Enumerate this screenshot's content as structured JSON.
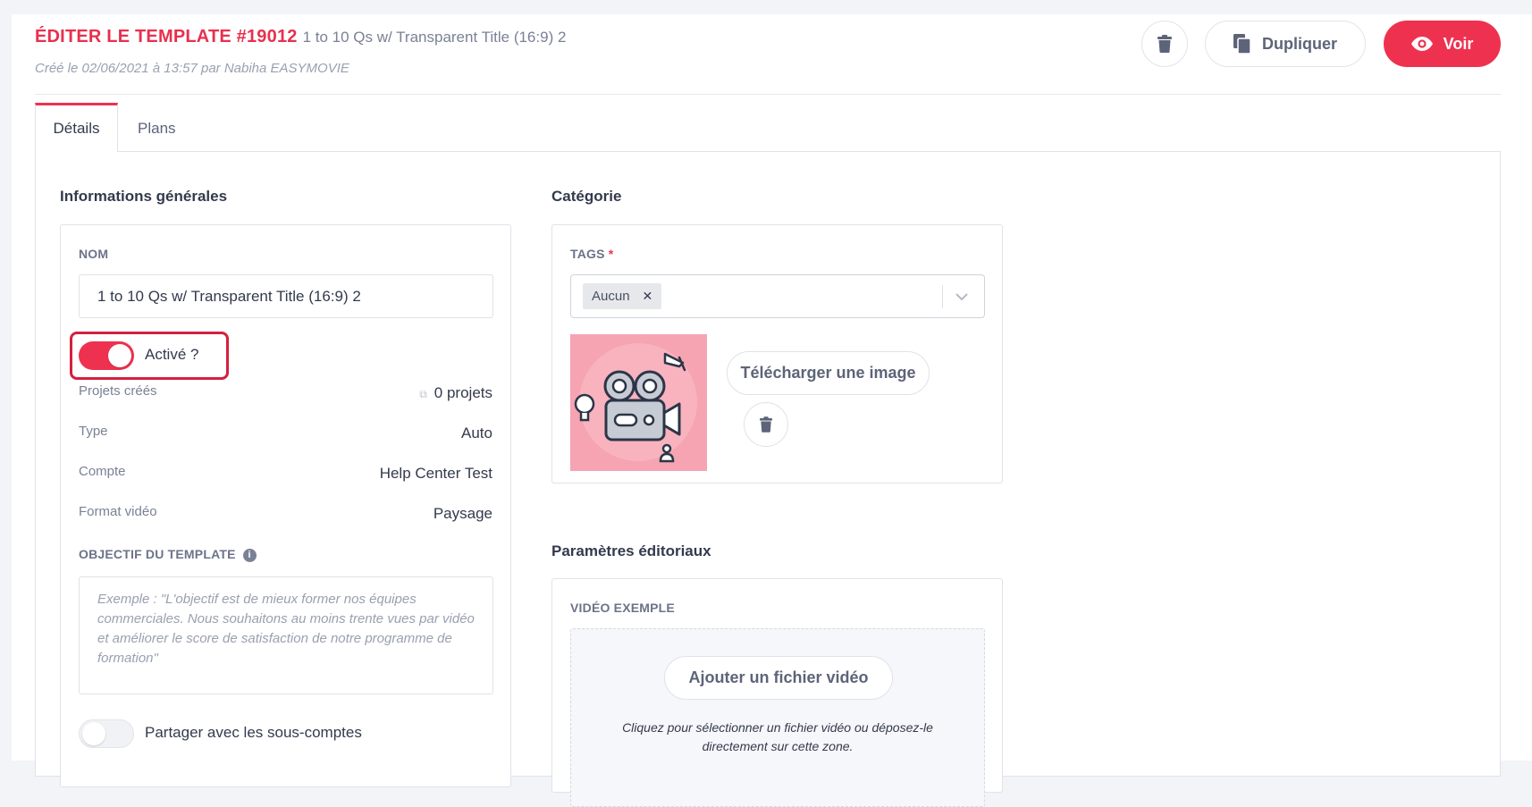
{
  "header": {
    "title": "ÉDITER LE TEMPLATE #19012",
    "template_name": "1 to 10 Qs w/ Transparent Title (16:9) 2",
    "created_info": "Créé le 02/06/2021 à 13:57 par Nabiha EASYMOVIE",
    "duplicate_label": "Dupliquer",
    "view_label": "Voir"
  },
  "tabs": [
    {
      "label": "Détails",
      "active": true
    },
    {
      "label": "Plans",
      "active": false
    }
  ],
  "general": {
    "section_title": "Informations générales",
    "name_label": "NOM",
    "name_value": "1 to 10 Qs w/ Transparent Title (16:9) 2",
    "active_label": "Activé ?",
    "active": true,
    "rows": [
      {
        "key": "Projets créés",
        "value": "0 projets"
      },
      {
        "key": "Type",
        "value": "Auto"
      },
      {
        "key": "Compte",
        "value": "Help Center Test"
      },
      {
        "key": "Format vidéo",
        "value": "Paysage"
      }
    ],
    "objective_label": "OBJECTIF DU TEMPLATE",
    "objective_placeholder": "Exemple : \"L'objectif est de mieux former nos équipes commerciales. Nous souhaitons au moins trente vues par vidéo et améliorer le score de satisfaction de notre programme de formation\"",
    "share_label": "Partager avec les sous-comptes",
    "share": false
  },
  "category": {
    "section_title": "Catégorie",
    "tags_label": "TAGS",
    "required_mark": "*",
    "tags": [
      "Aucun"
    ],
    "upload_label": "Télécharger une image"
  },
  "editorial": {
    "section_title": "Paramètres éditoriaux",
    "video_label": "VIDÉO EXEMPLE",
    "add_video_label": "Ajouter un fichier vidéo",
    "drop_hint_1": "Cliquez pour sélectionner un fichier vidéo ou déposez-le",
    "drop_hint_2": "directement sur cette zone."
  },
  "colors": {
    "accent": "#ef3150",
    "title_red": "#e8304e",
    "thumb_bg": "#f6a4b2"
  }
}
